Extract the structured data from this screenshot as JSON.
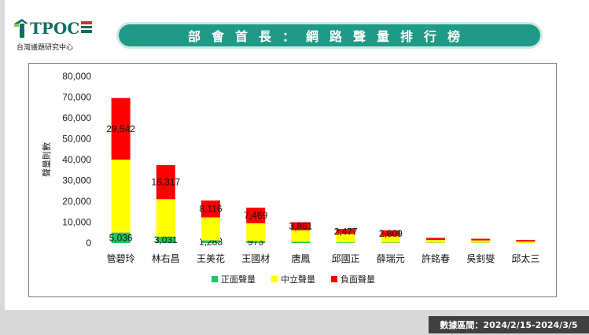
{
  "header": {
    "logo_text": "TPOC",
    "logo_subtitle": "台灣議題研究中心",
    "title": "部會首長：網路聲量排行榜"
  },
  "footer": {
    "date_range": "數據區間：2024/2/15-2024/3/5"
  },
  "colors": {
    "positive": "#22c55e",
    "neutral": "#ffff00",
    "negative": "#ff0000",
    "accent": "#1f9a86"
  },
  "chart_data": {
    "type": "bar",
    "stacked": true,
    "categories": [
      "管碧玲",
      "林右昌",
      "王美花",
      "王國材",
      "唐鳳",
      "邱國正",
      "薛瑞元",
      "許銘春",
      "吳釗燮",
      "邱太三"
    ],
    "series": [
      {
        "name": "正面聲量",
        "values": [
          5036,
          3031,
          1283,
          973,
          600,
          300,
          200,
          150,
          150,
          100
        ],
        "labels": [
          "5,036",
          "3,031",
          "1,283",
          "973",
          "",
          "",
          "",
          "",
          "",
          ""
        ]
      },
      {
        "name": "中立聲量",
        "values": [
          35000,
          18000,
          11000,
          8500,
          5500,
          4000,
          3000,
          1300,
          1100,
          600
        ],
        "labels": [
          "",
          "",
          "",
          "",
          "",
          "",
          "",
          "",
          "",
          ""
        ]
      },
      {
        "name": "負面聲量",
        "values": [
          29542,
          16317,
          8116,
          7469,
          3861,
          2477,
          2809,
          1000,
          800,
          800
        ],
        "labels": [
          "29,542",
          "16,317",
          "8,116",
          "7,469",
          "3,861",
          "2,477",
          "2,809",
          "",
          "",
          ""
        ]
      }
    ],
    "ylabel": "聲量則數",
    "ylim": [
      0,
      80000
    ],
    "yticks": [
      0,
      10000,
      20000,
      30000,
      40000,
      50000,
      60000,
      70000,
      80000
    ],
    "ytick_labels": [
      "0",
      "10,000",
      "20,000",
      "30,000",
      "40,000",
      "50,000",
      "60,000",
      "70,000",
      "80,000"
    ],
    "grid": false,
    "legend_position": "bottom"
  }
}
